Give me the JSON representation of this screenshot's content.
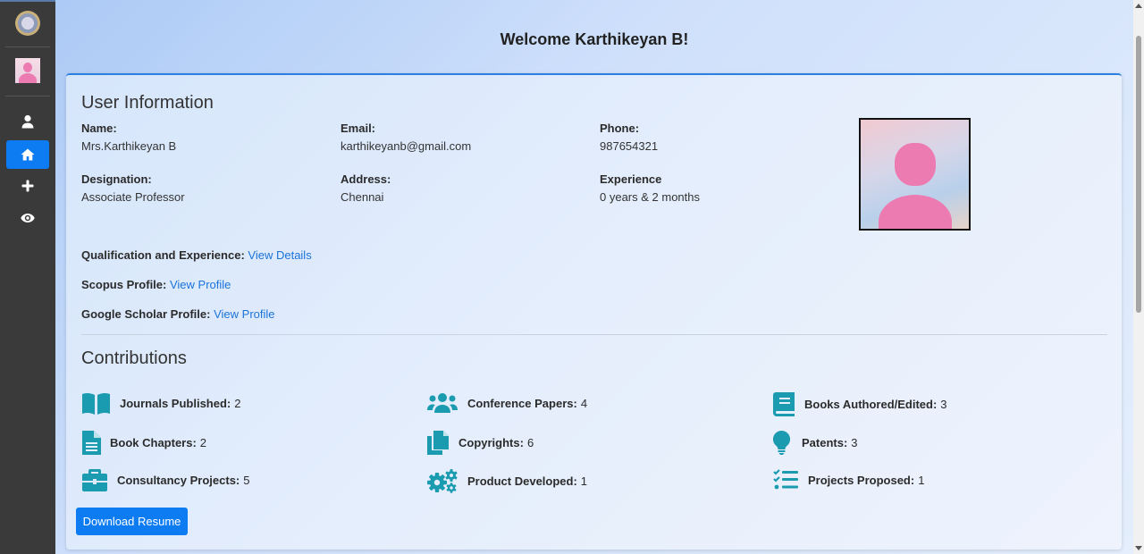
{
  "header": {
    "welcome": "Welcome Karthikeyan B!"
  },
  "user_info": {
    "title": "User Information",
    "name_label": "Name:",
    "name_value": "Mrs.Karthikeyan B",
    "email_label": "Email:",
    "email_value": "karthikeyanb@gmail.com",
    "phone_label": "Phone:",
    "phone_value": "987654321",
    "designation_label": "Designation:",
    "designation_value": "Associate Professor",
    "address_label": "Address:",
    "address_value": "Chennai",
    "experience_label": "Experience",
    "experience_value": "0 years & 2 months",
    "qualification_label": "Qualification and Experience:",
    "qualification_link": "View Details",
    "scopus_label": "Scopus Profile:",
    "scopus_link": "View Profile",
    "scholar_label": "Google Scholar Profile:",
    "scholar_link": "View Profile"
  },
  "contributions": {
    "title": "Contributions",
    "items": [
      {
        "label": "Journals Published:",
        "value": "2",
        "icon": "book-open-icon"
      },
      {
        "label": "Conference Papers:",
        "value": "4",
        "icon": "users-icon"
      },
      {
        "label": "Books Authored/Edited:",
        "value": "3",
        "icon": "book-icon"
      },
      {
        "label": "Book Chapters:",
        "value": "2",
        "icon": "file-text-icon"
      },
      {
        "label": "Copyrights:",
        "value": "6",
        "icon": "copy-icon"
      },
      {
        "label": "Patents:",
        "value": "3",
        "icon": "lightbulb-icon"
      },
      {
        "label": "Consultancy Projects:",
        "value": "5",
        "icon": "briefcase-icon"
      },
      {
        "label": "Product Developed:",
        "value": "1",
        "icon": "cogs-icon"
      },
      {
        "label": "Projects Proposed:",
        "value": "1",
        "icon": "tasks-icon"
      }
    ]
  },
  "actions": {
    "download_resume": "Download Resume"
  },
  "colors": {
    "accent": "#0d7cf2",
    "icon": "#1a9bb0",
    "link": "#1a73d9",
    "sidebar": "#3a3a3a"
  },
  "sidebar": {
    "icons": [
      "user-icon",
      "home-icon",
      "plus-icon",
      "eye-icon"
    ],
    "active": "home-icon"
  }
}
